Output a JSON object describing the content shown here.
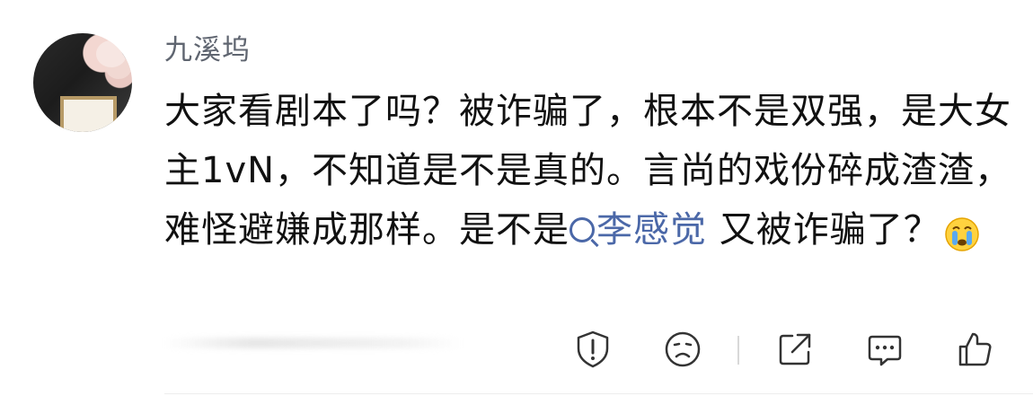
{
  "comment": {
    "username": "九溪坞",
    "text_before_tag": "大家看剧本了吗？被诈骗了，根本不是双强，是大女主1vN，不知道是不是真的。言尚的戏份碎成渣渣，难怪避嫌成那样。是不是",
    "tag_text": "李感觉",
    "text_after_tag": " 又被诈骗了？",
    "emoji": "crying-face"
  },
  "actions": {
    "items": [
      "report",
      "dislike",
      "share",
      "comment",
      "like"
    ]
  },
  "colors": {
    "text": "#111111",
    "username": "#5f6570",
    "link": "#4b68a8",
    "icon": "#333333"
  }
}
